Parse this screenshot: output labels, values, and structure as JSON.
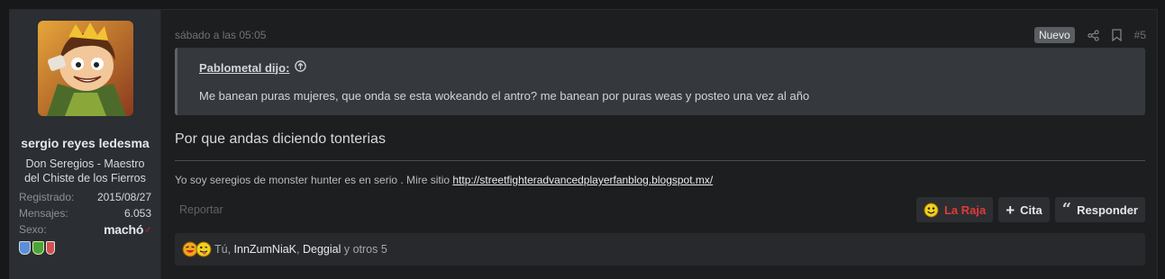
{
  "user": {
    "name": "sergio reyes ledesma",
    "title": "Don Seregios - Maestro del Chiste de los Fierros",
    "extras": [
      {
        "key": "Registrado:",
        "value": "2015/08/27"
      },
      {
        "key": "Mensajes:",
        "value": "6.053"
      }
    ],
    "gender_key": "Sexo:",
    "gender_value": "machó",
    "gender_symbol": "♂"
  },
  "post": {
    "date": "sábado a las 05:05",
    "new_badge": "Nuevo",
    "number": "#5",
    "quote": {
      "author": "Pablometal dijo:",
      "text": "Me banean puras mujeres, que onda se esta wokeando el antro? me banean por puras weas y posteo una vez al año"
    },
    "message": "Por que andas diciendo tonterias",
    "signature": {
      "text": "Yo soy seregios de monster hunter es en serio . Mire sitio ",
      "link": "http://streetfighteradvancedplayerfanblog.blogspot.mx/"
    },
    "report_label": "Reportar",
    "buttons": {
      "reaction": "La Raja",
      "quote": "Cita",
      "reply": "Responder"
    },
    "reactions": {
      "prefix": "Tú, ",
      "user1": "InnZumNiaK",
      "sep": ", ",
      "user2": "Deggial",
      "suffix": " y otros 5"
    }
  },
  "colors": {
    "accent_red": "#e03a3a",
    "emoji_yellow": "#f2cf1f"
  }
}
